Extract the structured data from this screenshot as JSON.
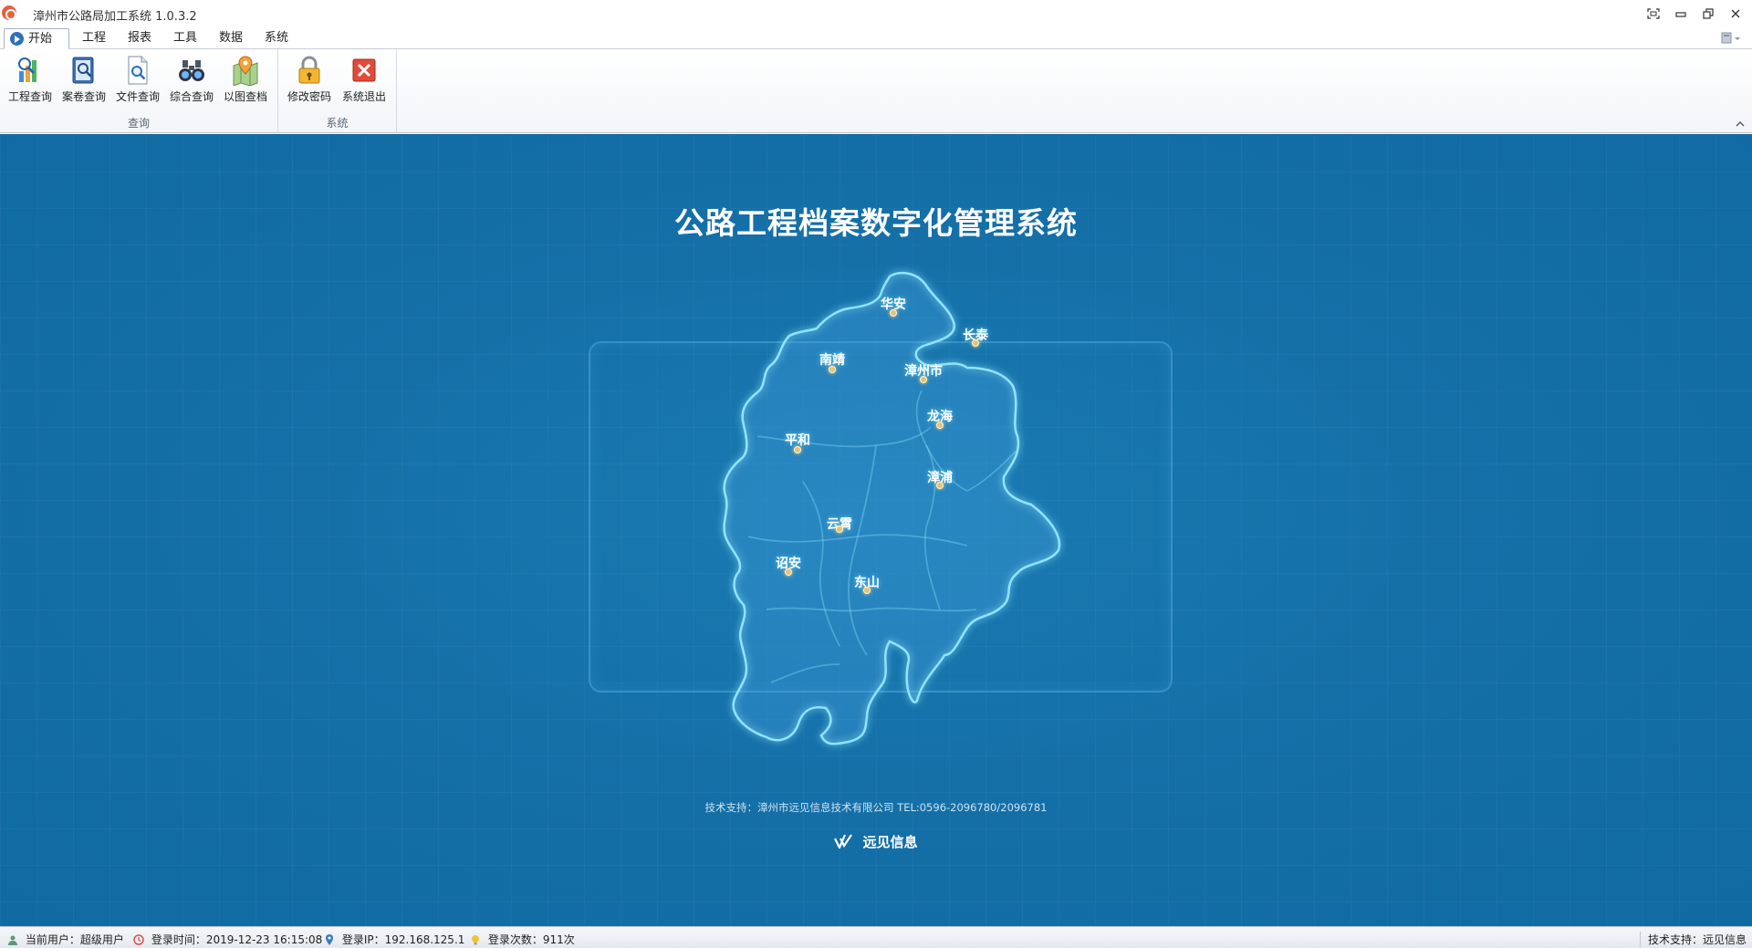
{
  "window": {
    "title": "漳州市公路局加工系统 1.0.3.2",
    "controls": [
      "fullscreen-icon",
      "minimize-icon",
      "restore-icon",
      "close-icon"
    ]
  },
  "menu": {
    "tabs": [
      {
        "label": "开始",
        "active": true
      },
      {
        "label": "工程",
        "active": false
      },
      {
        "label": "报表",
        "active": false
      },
      {
        "label": "工具",
        "active": false
      },
      {
        "label": "数据",
        "active": false
      },
      {
        "label": "系统",
        "active": false
      }
    ]
  },
  "ribbon": {
    "groups": [
      {
        "label": "查询",
        "buttons": [
          {
            "label": "工程查询",
            "icon": "project-query-icon"
          },
          {
            "label": "案卷查询",
            "icon": "file-box-query-icon"
          },
          {
            "label": "文件查询",
            "icon": "document-search-icon"
          },
          {
            "label": "综合查询",
            "icon": "binoculars-icon"
          },
          {
            "label": "以图查档",
            "icon": "map-pin-icon"
          }
        ]
      },
      {
        "label": "系统",
        "buttons": [
          {
            "label": "修改密码",
            "icon": "lock-icon"
          },
          {
            "label": "系统退出",
            "icon": "exit-icon"
          }
        ]
      }
    ]
  },
  "main": {
    "title": "公路工程档案数字化管理系统",
    "cities": [
      {
        "name": "华安"
      },
      {
        "name": "长泰"
      },
      {
        "name": "南靖"
      },
      {
        "name": "漳州市"
      },
      {
        "name": "龙海"
      },
      {
        "name": "平和"
      },
      {
        "name": "漳浦"
      },
      {
        "name": "云霄"
      },
      {
        "name": "诏安"
      },
      {
        "name": "东山"
      }
    ],
    "support_text": "技术支持：漳州市远见信息技术有限公司 TEL:0596-2096780/2096781",
    "brand": "远见信息"
  },
  "status": {
    "user_label": "当前用户：超级用户",
    "login_time_label": "登录时间：2019-12-23 16:15:08",
    "login_ip_label": "登录IP：192.168.125.1",
    "login_count_label": "登录次数：911次",
    "support_right": "技术支持：远见信息"
  },
  "colors": {
    "main_bg": "#1570a8",
    "map_glow": "#7fdcff",
    "city_dot": "#e6c27a"
  }
}
